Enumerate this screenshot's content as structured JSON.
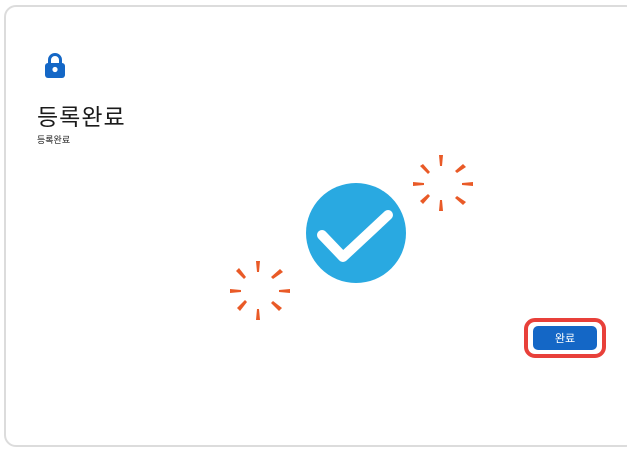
{
  "header": {
    "icon": "lock-icon",
    "title": "등록완료",
    "subtitle": "등록완료"
  },
  "illustration": {
    "icon": "checkmark-circle-icon",
    "accent_color": "#29a9e1",
    "sparkle_color": "#e95a27"
  },
  "footer": {
    "done_label": "완료",
    "button_color": "#1467c6",
    "highlight_color": "#e8403a"
  }
}
